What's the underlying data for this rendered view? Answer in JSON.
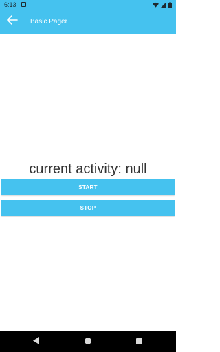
{
  "status_bar": {
    "time": "6:13"
  },
  "app_bar": {
    "title": "Basic Pager"
  },
  "main": {
    "activity_text": "current activity: null",
    "start_label": "START",
    "stop_label": "STOP"
  },
  "colors": {
    "accent": "#45c2ef",
    "nav": "#000000"
  },
  "icons": [
    "notification-icon",
    "wifi-icon",
    "signal-icon",
    "battery-icon",
    "back-arrow-icon",
    "nav-back-icon",
    "nav-home-icon",
    "nav-recent-icon"
  ]
}
